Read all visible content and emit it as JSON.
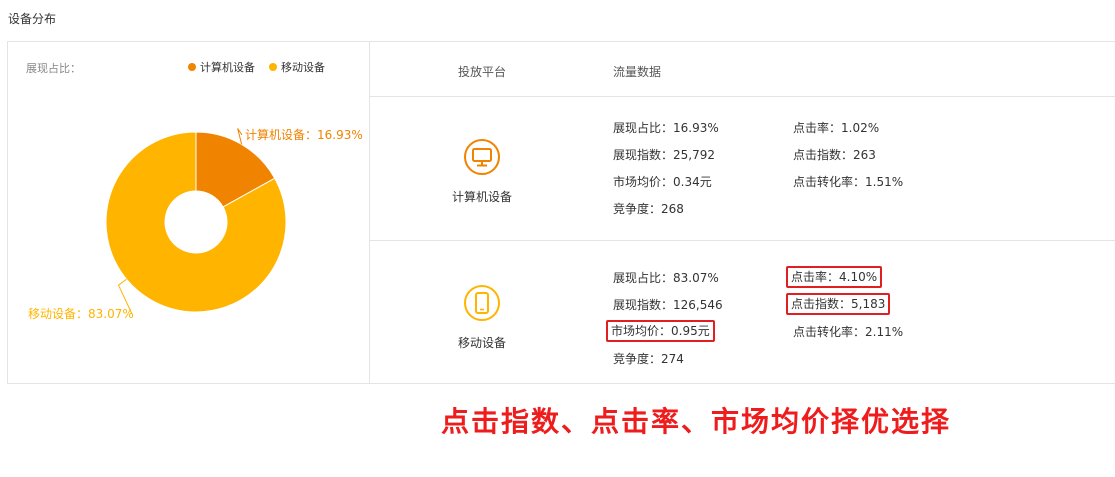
{
  "section_title": "设备分布",
  "left": {
    "share_label": "展现占比：",
    "legend": [
      {
        "name": "计算机设备",
        "color": "#f08300"
      },
      {
        "name": "移动设备",
        "color": "#ffb400"
      }
    ]
  },
  "chart_data": {
    "type": "pie",
    "donut": true,
    "slices": [
      {
        "name": "计算机设备",
        "value": 16.93,
        "color": "#f08300",
        "label": "计算机设备：16.93%"
      },
      {
        "name": "移动设备",
        "value": 83.07,
        "color": "#ffb400",
        "label": "移动设备：83.07%"
      }
    ]
  },
  "table": {
    "headers": {
      "platform": "投放平台",
      "traffic": "流量数据"
    },
    "rows": [
      {
        "platform": "计算机设备",
        "icon": "monitor-icon",
        "metrics": [
          {
            "text": "展现占比：16.93%",
            "highlight": false
          },
          {
            "text": "点击率：1.02%",
            "highlight": false
          },
          {
            "text": "展现指数：25,792",
            "highlight": false
          },
          {
            "text": "点击指数：263",
            "highlight": false
          },
          {
            "text": "市场均价：0.34元",
            "highlight": false
          },
          {
            "text": "点击转化率：1.51%",
            "highlight": false
          },
          {
            "text": "竞争度：268",
            "highlight": false
          }
        ]
      },
      {
        "platform": "移动设备",
        "icon": "phone-icon",
        "metrics": [
          {
            "text": "展现占比：83.07%",
            "highlight": false
          },
          {
            "text": "点击率：4.10%",
            "highlight": true
          },
          {
            "text": "展现指数：126,546",
            "highlight": false
          },
          {
            "text": "点击指数：5,183",
            "highlight": true
          },
          {
            "text": "市场均价：0.95元",
            "highlight": true
          },
          {
            "text": "点击转化率：2.11%",
            "highlight": false
          },
          {
            "text": "竞争度：274",
            "highlight": false
          }
        ]
      }
    ]
  },
  "callout": "点击指数、点击率、市场均价择优选择",
  "colors": {
    "pc": "#f08300",
    "mobile": "#ffb400",
    "highlight": "#e02020",
    "callout": "#ee1c1c"
  }
}
